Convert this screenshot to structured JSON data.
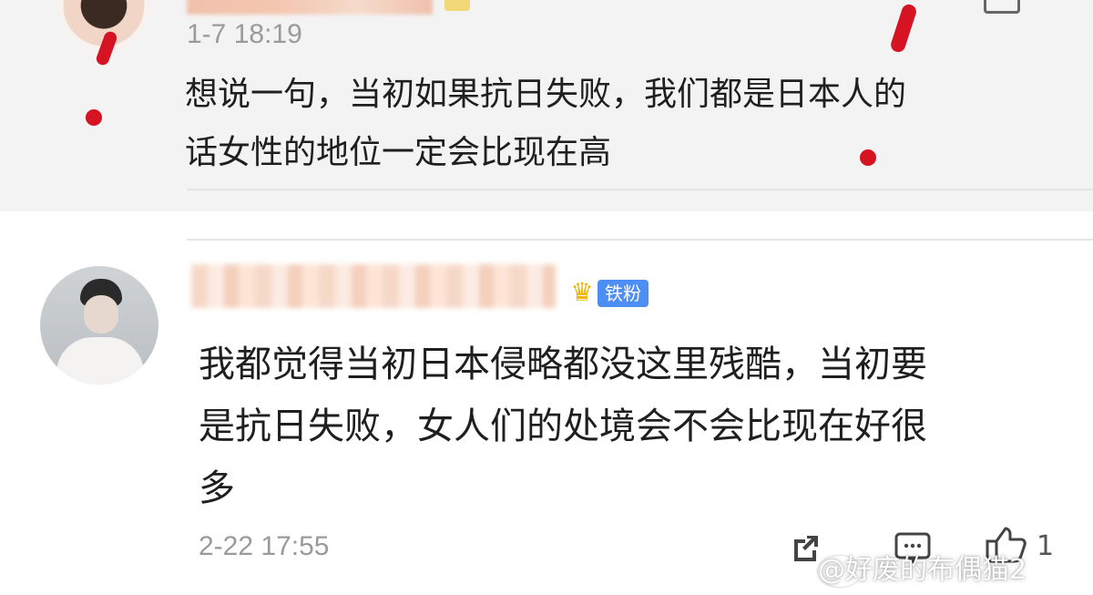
{
  "comments": [
    {
      "time": "1-7 18:19",
      "text": "想说一句，当初如果抗日失败，我们都是日本人的\n话女性的地位一定会比现在高"
    },
    {
      "badge": "铁粉",
      "time": "2-22 17:55",
      "text": "我都觉得当初日本侵略都没这里残酷，当初要\n是抗日失败，女人们的处境会不会比现在好很\n多",
      "likes": "1"
    }
  ],
  "icons": {
    "share": "share-icon",
    "comment": "comment-icon",
    "like": "thumb-up-icon",
    "crown": "crown-icon"
  },
  "watermark": "@好废的布偶猫2",
  "colors": {
    "accent_red": "#d61323",
    "badge_blue": "#4c8ef4",
    "muted_gray": "#9a9a9a"
  }
}
